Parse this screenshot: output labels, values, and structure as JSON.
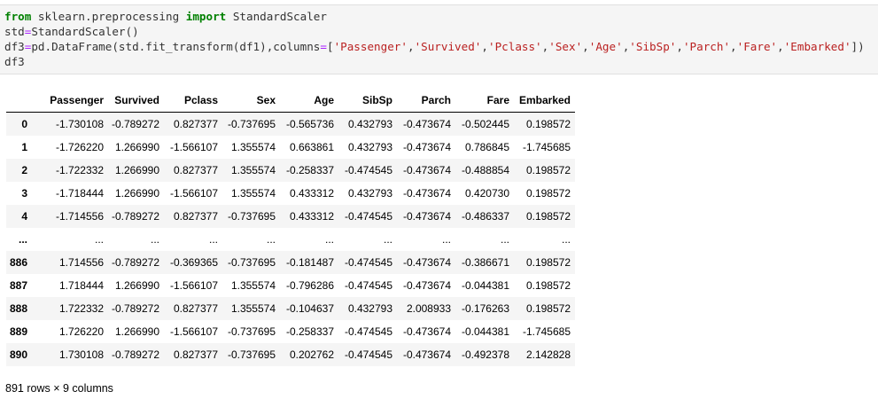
{
  "code_cell": {
    "line1": {
      "kw_from": "from",
      "module": " sklearn.preprocessing ",
      "kw_import": "import",
      "name": " StandardScaler"
    },
    "line2": {
      "lhs": "std",
      "eq": "=",
      "rhs": "StandardScaler()"
    },
    "line3": {
      "lhs": "df3",
      "eq": "=",
      "call": "pd.DataFrame(std.fit_transform(df1),columns",
      "eq2": "=",
      "open": "[",
      "items": [
        "'Passenger'",
        "'Survived'",
        "'Pclass'",
        "'Sex'",
        "'Age'",
        "'SibSp'",
        "'Parch'",
        "'Fare'",
        "'Embarked'"
      ],
      "sep": ",",
      "close": "])"
    },
    "line4": "df3"
  },
  "dataframe": {
    "columns": [
      "",
      "Passenger",
      "Survived",
      "Pclass",
      "Sex",
      "Age",
      "SibSp",
      "Parch",
      "Fare",
      "Embarked"
    ],
    "rows": [
      [
        "0",
        "-1.730108",
        "-0.789272",
        "0.827377",
        "-0.737695",
        "-0.565736",
        "0.432793",
        "-0.473674",
        "-0.502445",
        "0.198572"
      ],
      [
        "1",
        "-1.726220",
        "1.266990",
        "-1.566107",
        "1.355574",
        "0.663861",
        "0.432793",
        "-0.473674",
        "0.786845",
        "-1.745685"
      ],
      [
        "2",
        "-1.722332",
        "1.266990",
        "0.827377",
        "1.355574",
        "-0.258337",
        "-0.474545",
        "-0.473674",
        "-0.488854",
        "0.198572"
      ],
      [
        "3",
        "-1.718444",
        "1.266990",
        "-1.566107",
        "1.355574",
        "0.433312",
        "0.432793",
        "-0.473674",
        "0.420730",
        "0.198572"
      ],
      [
        "4",
        "-1.714556",
        "-0.789272",
        "0.827377",
        "-0.737695",
        "0.433312",
        "-0.474545",
        "-0.473674",
        "-0.486337",
        "0.198572"
      ],
      [
        "...",
        "...",
        "...",
        "...",
        "...",
        "...",
        "...",
        "...",
        "...",
        "..."
      ],
      [
        "886",
        "1.714556",
        "-0.789272",
        "-0.369365",
        "-0.737695",
        "-0.181487",
        "-0.474545",
        "-0.473674",
        "-0.386671",
        "0.198572"
      ],
      [
        "887",
        "1.718444",
        "1.266990",
        "-1.566107",
        "1.355574",
        "-0.796286",
        "-0.474545",
        "-0.473674",
        "-0.044381",
        "0.198572"
      ],
      [
        "888",
        "1.722332",
        "-0.789272",
        "0.827377",
        "1.355574",
        "-0.104637",
        "0.432793",
        "2.008933",
        "-0.176263",
        "0.198572"
      ],
      [
        "889",
        "1.726220",
        "1.266990",
        "-1.566107",
        "-0.737695",
        "-0.258337",
        "-0.474545",
        "-0.473674",
        "-0.044381",
        "-1.745685"
      ],
      [
        "890",
        "1.730108",
        "-0.789272",
        "0.827377",
        "-0.737695",
        "0.202762",
        "-0.474545",
        "-0.473674",
        "-0.492378",
        "2.142828"
      ]
    ]
  },
  "summary": "891 rows × 9 columns",
  "colors": {
    "code_background": "#f5f5f5",
    "keyword": "#008000",
    "operator": "#aa22ff",
    "string": "#ba2121",
    "row_stripe": "#f5f5f5"
  }
}
